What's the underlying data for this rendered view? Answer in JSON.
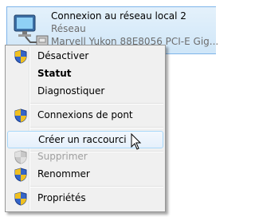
{
  "connection": {
    "name": "Connexion au réseau local 2",
    "status": "Réseau",
    "adapter": "Marvell Yukon 88E8056 PCI-E Gig..."
  },
  "menu": {
    "items": [
      {
        "label": "Désactiver",
        "icon": "uac-shield-icon"
      },
      {
        "label": "Statut"
      },
      {
        "label": "Diagnostiquer"
      },
      {
        "label": "Connexions de pont",
        "icon": "uac-shield-icon"
      },
      {
        "label": "Créer un raccourci"
      },
      {
        "label": "Supprimer",
        "icon": "uac-shield-icon"
      },
      {
        "label": "Renommer",
        "icon": "uac-shield-icon"
      },
      {
        "label": "Propriétés",
        "icon": "uac-shield-icon"
      }
    ]
  },
  "colors": {
    "selection": "#cfe6f8",
    "menu_bg": "#f0f0f0",
    "disabled_text": "#a0a0a0"
  }
}
